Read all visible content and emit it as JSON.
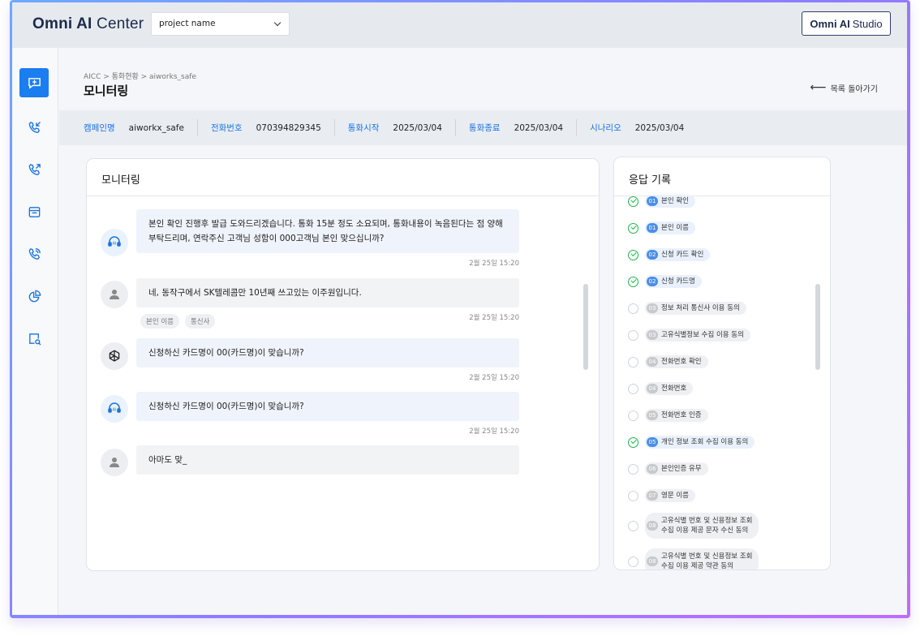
{
  "header": {
    "logo_bold": "Omni AI",
    "logo_rest": " Center",
    "project_select_value": "project name",
    "studio_bold": "Omni AI",
    "studio_rest": "Studio"
  },
  "sidebar": {
    "items": [
      {
        "name": "monitoring",
        "icon": "chat-bubble-icon",
        "active": true
      },
      {
        "name": "inbound-call",
        "icon": "phone-incoming-icon"
      },
      {
        "name": "outbound-call",
        "icon": "phone-outgoing-icon"
      },
      {
        "name": "calendar",
        "icon": "calendar-icon"
      },
      {
        "name": "call-status",
        "icon": "phone-ringing-icon"
      },
      {
        "name": "statistics",
        "icon": "pie-chart-icon"
      },
      {
        "name": "search-doc",
        "icon": "document-search-icon"
      }
    ]
  },
  "page": {
    "breadcrumb": "AICC > 통화현황 > aiworks_safe",
    "title": "모니터링",
    "back_label": "목록 돌아가기"
  },
  "info": {
    "campaign_label": "캠페인명",
    "campaign_value": "aiworkx_safe",
    "phone_label": "전화번호",
    "phone_value": "070394829345",
    "start_label": "통화시작",
    "start_value": "2025/03/04",
    "end_label": "통화종료",
    "end_value": "2025/03/04",
    "scenario_label": "시나리오",
    "scenario_value": "2025/03/04"
  },
  "monitor": {
    "title": "모니터링",
    "messages": [
      {
        "type": "ai",
        "text": "본인 확인 진행후 발급 도와드리겠습니다. 통화 15분 정도 소요되며, 통화내용이 녹음된다는 점 양해부탁드리며, 연락주신 고객님 성함이 000고객님 본인 맞으십니까?",
        "time": "2월 25일 15:20"
      },
      {
        "type": "user",
        "text": "네, 동작구에서 SK텔레콤만 10년째 쓰고있는 이주원입니다.",
        "time": "2월 25일 15:20",
        "tags": [
          "본인 이름",
          "통신사"
        ]
      },
      {
        "type": "gpt",
        "text": "신청하신 카드명이 00(카드명)이 맞습니까?",
        "time": "2월 25일 15:20"
      },
      {
        "type": "ai",
        "text": "신청하신 카드명이 00(카드명)이 맞습니까?",
        "time": "2월 25일 15:20"
      },
      {
        "type": "user",
        "text": "아마도 맞_",
        "time": ""
      }
    ]
  },
  "records": {
    "title": "응답 기록",
    "items": [
      {
        "num": "01",
        "label": "본인 확인",
        "done": true
      },
      {
        "num": "01",
        "label": "본인 이름",
        "done": true
      },
      {
        "num": "02",
        "label": "신청 카드 확인",
        "done": true
      },
      {
        "num": "02",
        "label": "신청 카드명",
        "done": true
      },
      {
        "num": "03",
        "label": "정보 처리 통신사 이용 동의",
        "done": false
      },
      {
        "num": "03",
        "label": "고유식별정보 수집 이용 동의",
        "done": false
      },
      {
        "num": "04",
        "label": "전화번호 확인",
        "done": false
      },
      {
        "num": "04",
        "label": "전화번호",
        "done": false
      },
      {
        "num": "05",
        "label": "전화번호 인증",
        "done": false
      },
      {
        "num": "05",
        "label": "개인 정보 조회 수집 이용 동의",
        "done": true
      },
      {
        "num": "06",
        "label": "본인인증 유무",
        "done": false
      },
      {
        "num": "07",
        "label": "영문 이름",
        "done": false
      },
      {
        "num": "08",
        "label": "고유식별 번호 및 신용정보 조회",
        "label2": "수집 이용 제공 문자 수신 동의",
        "done": false
      },
      {
        "num": "08",
        "label": "고유식별 번호 및 신용정보 조회",
        "label2": "수집 이용 제공 약관 동의",
        "done": false
      }
    ]
  },
  "colors": {
    "accent": "#1a7df0",
    "check_green": "#22b24c",
    "frame_gradient_start": "#6fa8ff",
    "frame_gradient_end": "#c06bff"
  }
}
